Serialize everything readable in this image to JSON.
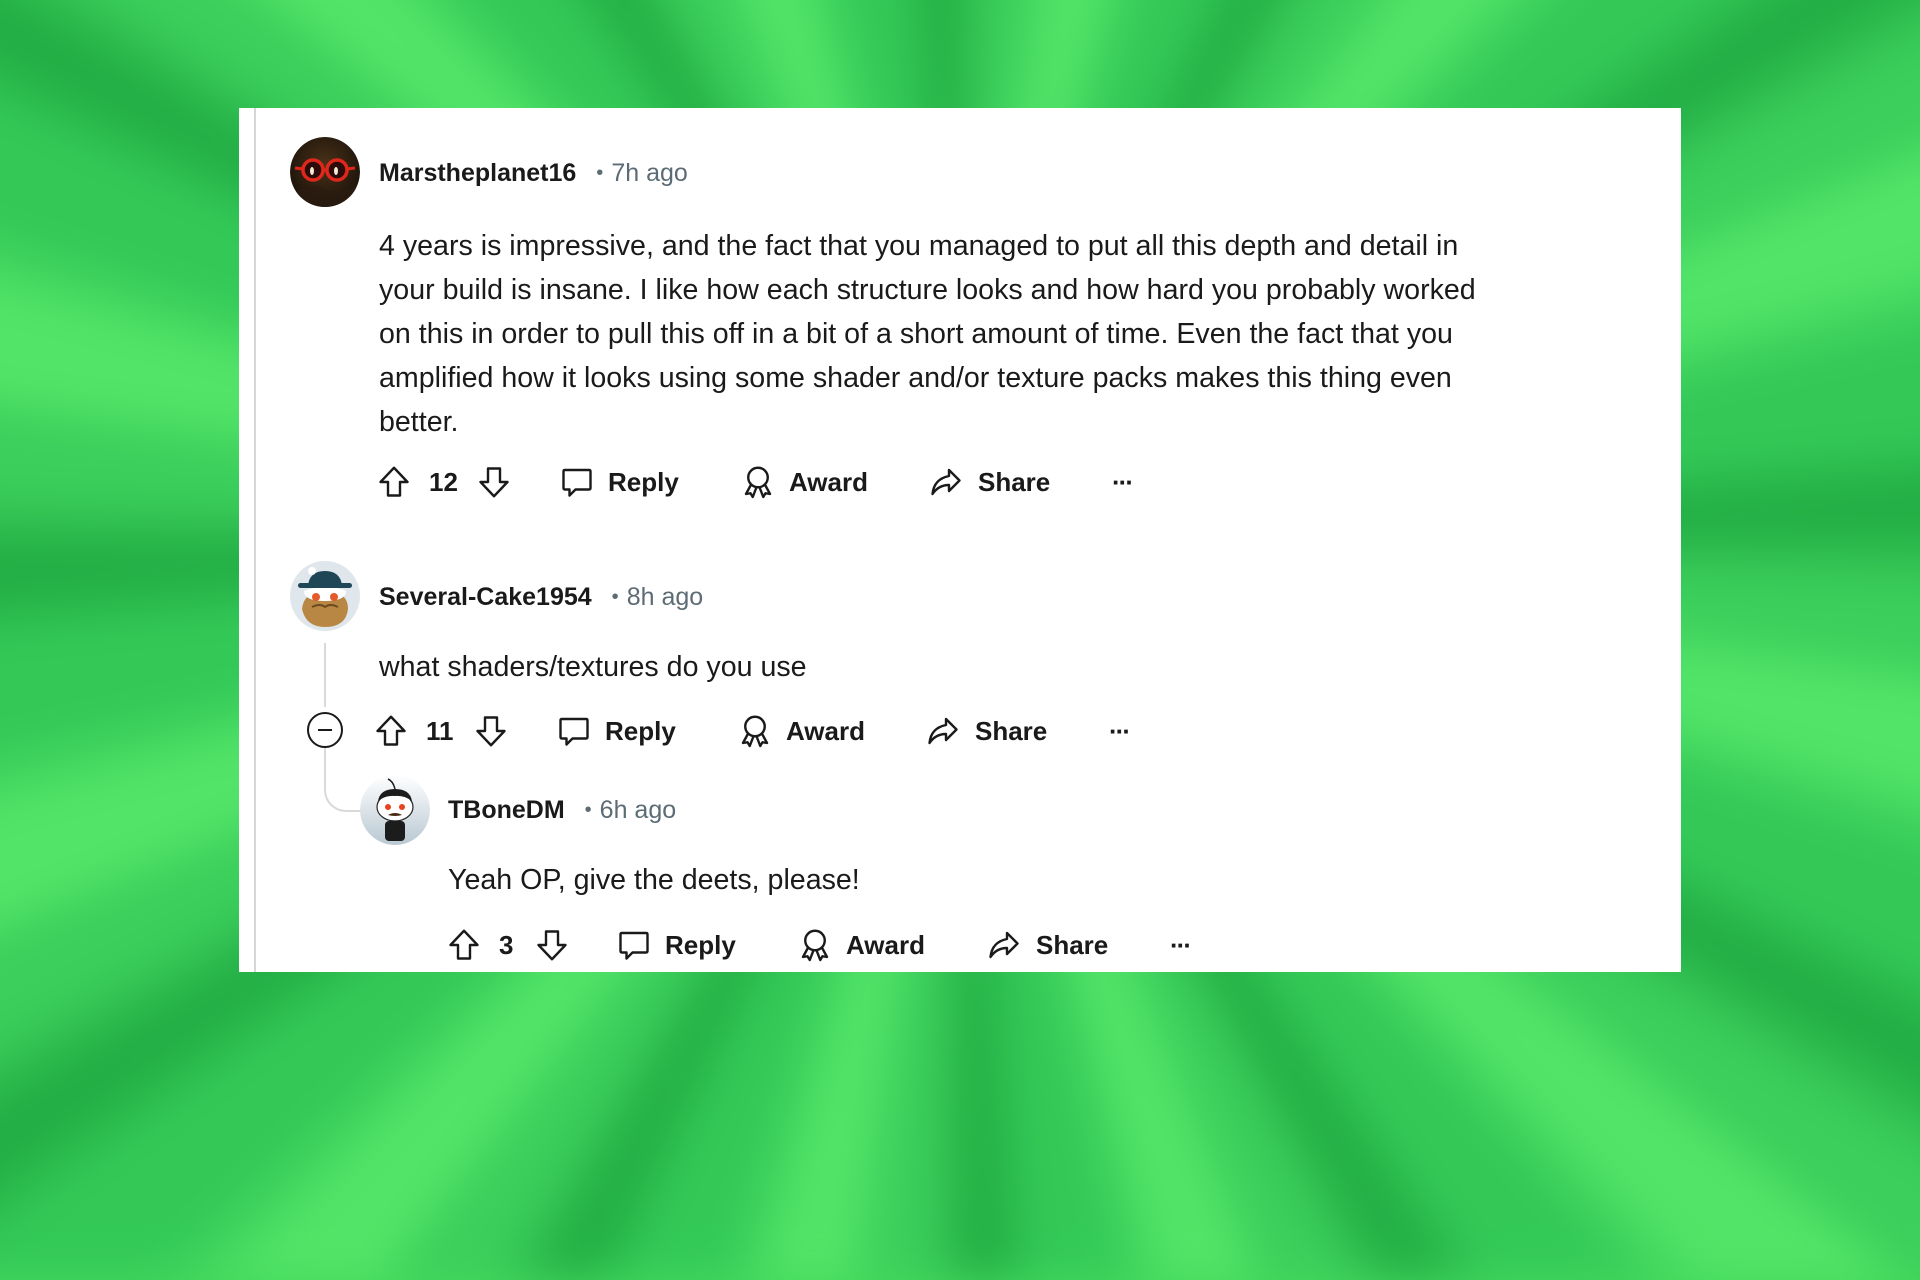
{
  "colors": {
    "background_green": "#45d95d",
    "card": "#ffffff",
    "text": "#1a1a1b",
    "meta_text": "#5c6c74",
    "thread_line": "#d9d9d9"
  },
  "comments": [
    {
      "username": "Marstheplanet16",
      "separator": "•",
      "time": "7h ago",
      "body_lines": [
        "4 years is impressive, and the fact that you managed to put all this depth and detail in",
        "your build is insane. I like how each structure looks and how hard you probably worked",
        "on this in order to pull this off in a bit of a short amount of time. Even the fact that you",
        "amplified how it looks using some shader and/or texture packs makes this thing even",
        "better."
      ],
      "votes": "12",
      "actions": {
        "reply": "Reply",
        "award": "Award",
        "share": "Share",
        "more": "···"
      },
      "icons": {
        "upvote": "arrow-up-outline",
        "downvote": "arrow-down-outline",
        "reply": "speech-bubble",
        "award": "ribbon-award",
        "share": "curved-arrow-right",
        "more": "horizontal-ellipsis"
      }
    },
    {
      "username": "Several-Cake1954",
      "separator": "•",
      "time": "8h ago",
      "body_lines": [
        "what shaders/textures do you use"
      ],
      "votes": "11",
      "actions": {
        "reply": "Reply",
        "award": "Award",
        "share": "Share",
        "more": "···"
      },
      "collapse_icon": "circle-minus"
    },
    {
      "username": "TBoneDM",
      "separator": "•",
      "time": "6h ago",
      "body_lines": [
        "Yeah OP, give the deets, please!"
      ],
      "votes": "3",
      "actions": {
        "reply": "Reply",
        "award": "Award",
        "share": "Share",
        "more": "···"
      }
    }
  ]
}
